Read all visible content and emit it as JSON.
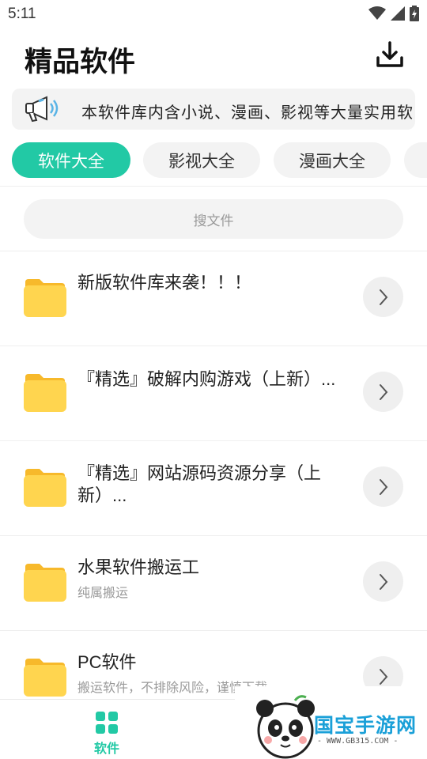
{
  "status": {
    "time": "5:11"
  },
  "header": {
    "title": "精品软件"
  },
  "notice": {
    "text": "本软件库内含小说、漫画、影视等大量实用软"
  },
  "tabs": [
    {
      "label": "软件大全",
      "active": true
    },
    {
      "label": "影视大全",
      "active": false
    },
    {
      "label": "漫画大全",
      "active": false
    }
  ],
  "search": {
    "placeholder": "搜文件"
  },
  "list": [
    {
      "title": "新版软件库来袭！！！",
      "subtitle": ""
    },
    {
      "title": "『精选』破解内购游戏（上新）...",
      "subtitle": ""
    },
    {
      "title": "『精选』网站源码资源分享（上新）...",
      "subtitle": ""
    },
    {
      "title": "水果软件搬运工",
      "subtitle": "纯属搬运"
    },
    {
      "title": "PC软件",
      "subtitle": "搬运软件，不排除风险，谨慎下载"
    }
  ],
  "bottom_nav": {
    "label": "软件"
  },
  "watermark": {
    "text": "国宝手游网",
    "url": "- WWW.GB315.COM -"
  },
  "colors": {
    "accent": "#22c9a5",
    "folder": "#ffd54f",
    "chip_bg": "#f3f3f3"
  },
  "icons": [
    "wifi-icon",
    "signal-icon",
    "battery-icon",
    "download-icon",
    "megaphone-icon",
    "folder-icon",
    "chevron-right-icon",
    "grid-icon"
  ]
}
